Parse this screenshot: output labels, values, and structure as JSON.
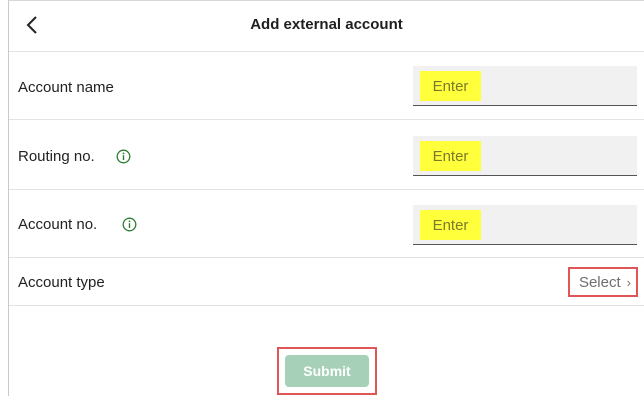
{
  "header": {
    "title": "Add external account",
    "back_icon": "chevron-left-icon"
  },
  "fields": [
    {
      "label": "Account name",
      "placeholder": "Enter",
      "has_info": false
    },
    {
      "label": "Routing no.",
      "placeholder": "Enter",
      "has_info": true,
      "info_icon": "info-icon"
    },
    {
      "label": "Account no.",
      "placeholder": "Enter",
      "has_info": true,
      "info_icon": "info-icon"
    }
  ],
  "account_type": {
    "label": "Account type",
    "value": "Select",
    "chevron": "›"
  },
  "submit": {
    "label": "Submit"
  },
  "colors": {
    "accent_green": "#2e7d32",
    "submit_bg": "#a6d1b8",
    "highlight_yellow": "#ffff3c",
    "annotation_red": "#e05656"
  }
}
